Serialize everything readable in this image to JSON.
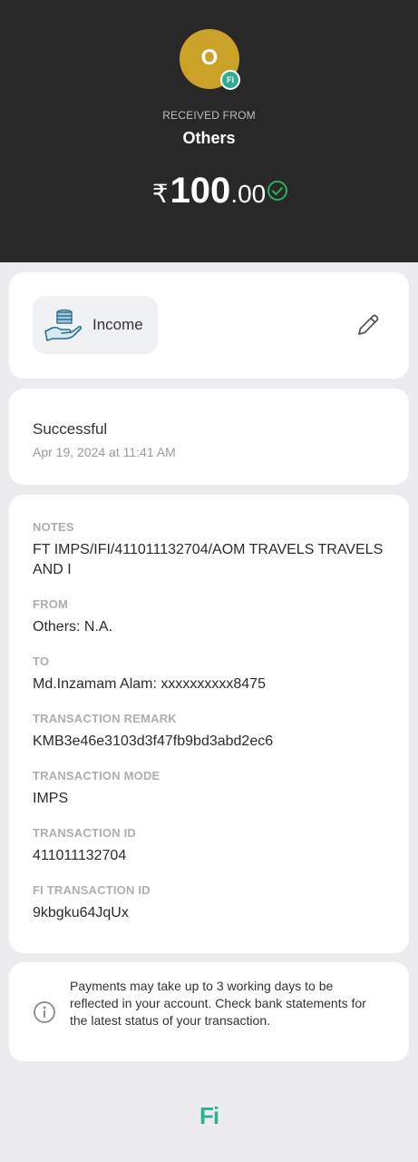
{
  "header": {
    "avatar_letter": "O",
    "badge_text": "Fi",
    "received_label": "RECEIVED FROM",
    "sender_name": "Others",
    "amount": {
      "currency": "₹",
      "integer": "100",
      "decimal": ".00"
    }
  },
  "category": {
    "label": "Income",
    "icon": "income-hand-coins-icon"
  },
  "status": {
    "text": "Successful",
    "date": "Apr 19, 2024 at 11:41 AM"
  },
  "details": [
    {
      "label": "NOTES",
      "value": "FT IMPS/IFI/411011132704/AOM TRAVELS TRAVELS AND I"
    },
    {
      "label": "FROM",
      "value": "Others: N.A."
    },
    {
      "label": "TO",
      "value": "Md.Inzamam Alam: xxxxxxxxxx8475"
    },
    {
      "label": "TRANSACTION REMARK",
      "value": "KMB3e46e3103d3f47fb9bd3abd2ec6"
    },
    {
      "label": "TRANSACTION MODE",
      "value": "IMPS"
    },
    {
      "label": "TRANSACTION ID",
      "value": "411011132704"
    },
    {
      "label": "FI TRANSACTION ID",
      "value": "9kbgku64JqUx"
    }
  ],
  "info": {
    "text": "Payments may take up to 3 working days to be reflected in your account. Check bank statements for the latest status of your transaction."
  },
  "footer": {
    "logo_text": "Fi"
  },
  "colors": {
    "header_bg": "#282828",
    "avatar": "#c9a227",
    "accent": "#2fae91",
    "success": "#2fae5f"
  }
}
